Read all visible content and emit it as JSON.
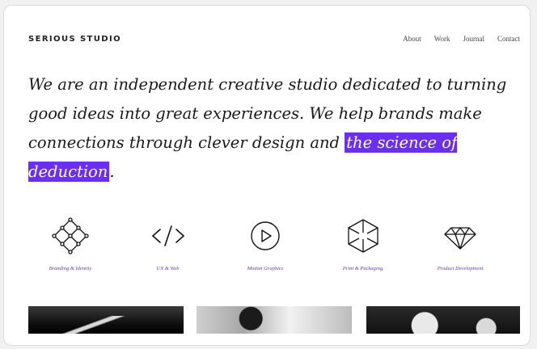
{
  "header": {
    "logo_text": "SERIOUS STUDIO",
    "nav": [
      "About",
      "Work",
      "Journal",
      "Contact"
    ]
  },
  "hero": {
    "text": "We are an independent creative studio dedicated to turning good ideas into great experiences. We help brands make connections through clever design and ",
    "highlight": "the science of deduction",
    "end": ".",
    "highlight_color": "#6a2ff0"
  },
  "services": [
    {
      "icon": "diamond-grid-icon",
      "label": "Branding & Identity"
    },
    {
      "icon": "code-icon",
      "label": "UX & Web"
    },
    {
      "icon": "play-icon",
      "label": "Motion Graphics"
    },
    {
      "icon": "cube-icon",
      "label": "Print & Packaging"
    },
    {
      "icon": "gem-icon",
      "label": "Product Development"
    }
  ],
  "accent_color": "#6a2ff0"
}
